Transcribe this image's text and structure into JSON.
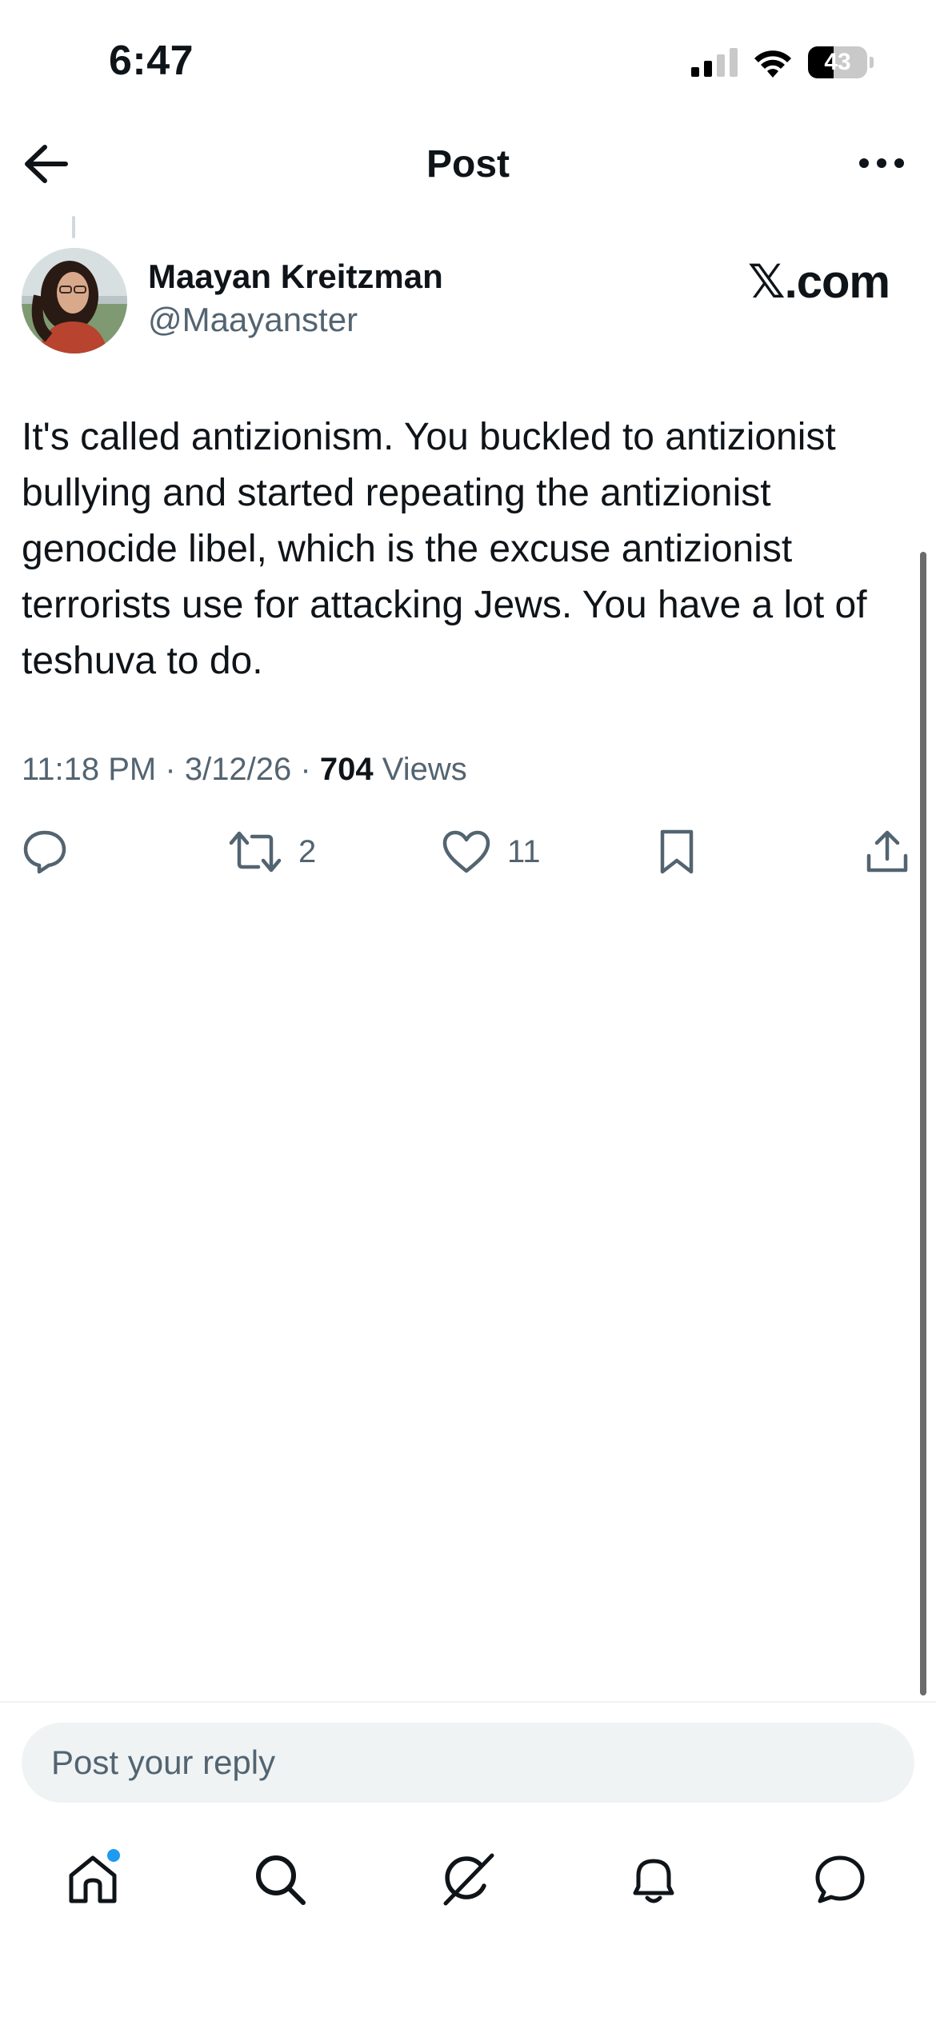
{
  "status_bar": {
    "time": "6:47",
    "battery_level": "43",
    "battery_fraction": 0.43
  },
  "header": {
    "title": "Post"
  },
  "post": {
    "author_name": "Maayan Kreitzman",
    "author_handle": "@Maayanster",
    "brand": "𝕏.com",
    "text": "It's called antizionism. You buckled to antizionist bullying and started repeating the antizionist genocide libel, which is the excuse antizionist terrorists use for attacking Jews. You have a lot of teshuva to do.",
    "time": "11:18 PM",
    "date": "3/12/26",
    "separator": "·",
    "views_count": "704",
    "views_label": "Views",
    "reposts": "2",
    "likes": "11"
  },
  "reply": {
    "placeholder": "Post your reply"
  },
  "tabbar": {
    "home_has_notification": true
  },
  "colors": {
    "text_primary": "#0f1419",
    "text_secondary": "#536471",
    "accent": "#1d9bf0",
    "reply_bg": "#eff3f4"
  },
  "icons": {
    "back": "arrow-left-icon",
    "more": "ellipsis-icon",
    "reply": "speech-bubble-icon",
    "repost": "repost-icon",
    "like": "heart-icon",
    "bookmark": "bookmark-icon",
    "share": "share-upload-icon",
    "home": "home-icon",
    "search": "search-icon",
    "grok": "grok-icon",
    "notifications": "bell-icon",
    "messages": "message-bubble-icon"
  }
}
